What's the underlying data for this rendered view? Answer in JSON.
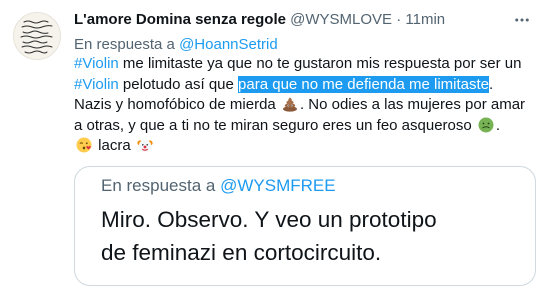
{
  "tweet": {
    "display_name": "L'amore Domina senza regole",
    "handle": "@WYSMLOVE",
    "separator": "·",
    "time": "11min",
    "more_icon": "more-horizontal-icon",
    "reply_prefix": "En respuesta a",
    "reply_to": "@HoannSetrid",
    "body": {
      "l1_tag": "#Violin",
      "l1_text": " me limitaste ya que no te gustaron mis respuesta por ser un",
      "l2_tag": "#Violin",
      "l2_text": " pelotudo así que ",
      "l2_highlight": "para que no me defienda me limitaste",
      "l2_end": ".",
      "l3_text": "Nazis y homofóbico de mierda ",
      "l3_emoji": "pile-of-poo-icon",
      "l3_end": ". No odies a las mujeres por amar",
      "l4_text": "a otras, y que a ti no te miran seguro eres un feo asqueroso ",
      "l4_emoji": "nauseated-face-icon",
      "l4_end": ".",
      "l5_emoji1": "kissing-face-icon",
      "l5_text": " lacra ",
      "l5_emoji2": "clown-face-icon"
    }
  },
  "quote": {
    "reply_prefix": "En respuesta a",
    "reply_to": "@WYSMFREE",
    "line1": "Miro. Observo. Y veo un prototipo",
    "line2": "de feminazi en cortocircuito."
  },
  "colors": {
    "accent": "#1d9bf0",
    "text": "#0f1419",
    "muted": "#536471"
  }
}
